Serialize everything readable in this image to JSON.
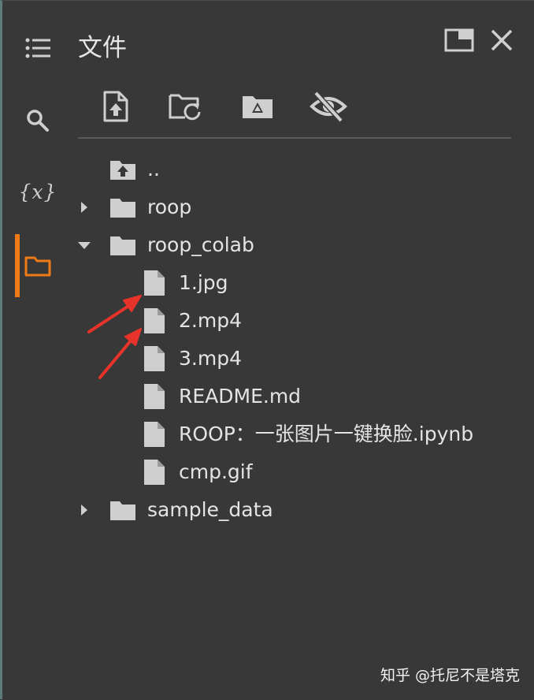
{
  "panel": {
    "title": "文件"
  },
  "rail": {
    "items": [
      {
        "icon": "list-icon",
        "active": false
      },
      {
        "icon": "search-icon",
        "active": false
      },
      {
        "icon": "variables-icon",
        "glyph": "{x}",
        "active": false
      },
      {
        "icon": "folder-icon",
        "active": true
      }
    ]
  },
  "toolbar": {
    "items": [
      {
        "icon": "upload-file-icon"
      },
      {
        "icon": "refresh-folder-icon"
      },
      {
        "icon": "google-drive-icon"
      },
      {
        "icon": "hide-eye-icon"
      }
    ]
  },
  "window_controls": {
    "items": [
      {
        "icon": "maximize-icon"
      },
      {
        "icon": "close-icon"
      }
    ]
  },
  "tree": {
    "parent": {
      "label": ".."
    },
    "items": [
      {
        "label": "roop",
        "type": "folder",
        "expanded": false
      },
      {
        "label": "roop_colab",
        "type": "folder",
        "expanded": true
      },
      {
        "label": "1.jpg",
        "type": "file"
      },
      {
        "label": "2.mp4",
        "type": "file"
      },
      {
        "label": "3.mp4",
        "type": "file"
      },
      {
        "label": "README.md",
        "type": "file"
      },
      {
        "label": "ROOP：一张图片一键换脸.ipynb",
        "type": "file"
      },
      {
        "label": "cmp.gif",
        "type": "file"
      },
      {
        "label": "sample_data",
        "type": "folder",
        "expanded": false
      }
    ]
  },
  "annotation": {
    "arrow_color": "#e8332a"
  },
  "watermark": {
    "text": "知乎 @托尼不是塔克"
  },
  "colors": {
    "background": "#383838",
    "accent": "#f07a15",
    "icon": "#cfcfcf",
    "text": "#e4e4e4"
  }
}
